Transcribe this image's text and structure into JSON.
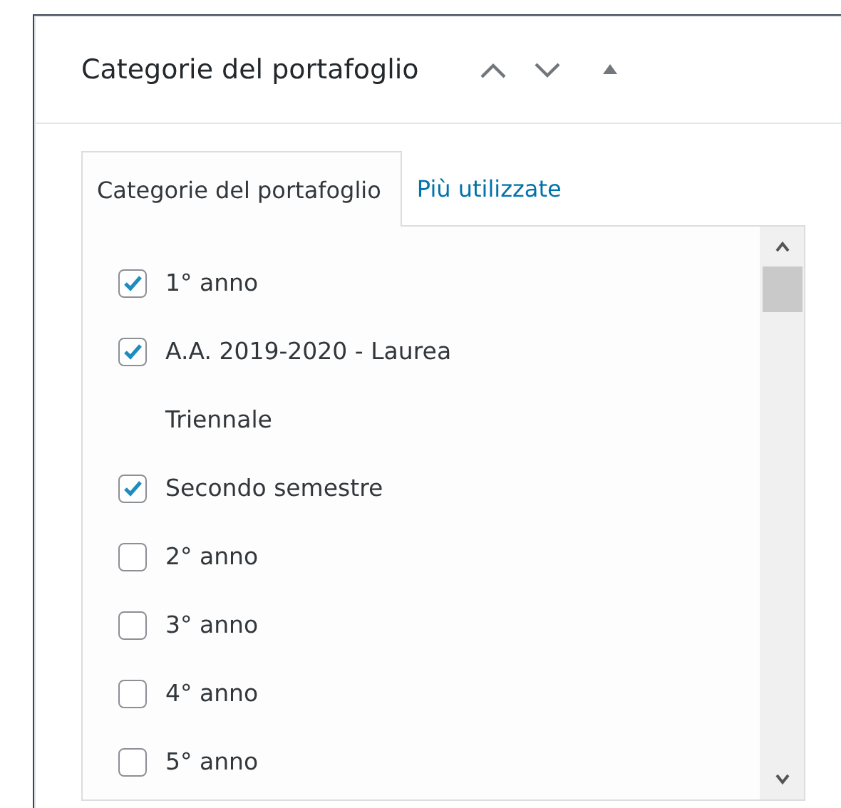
{
  "panel": {
    "title": "Categorie del portafoglio"
  },
  "tabs": [
    {
      "label": "Categorie del portafoglio",
      "selected": true
    },
    {
      "label": "Più utilizzate",
      "selected": false
    }
  ],
  "categories": [
    {
      "label": "1° anno",
      "checked": true
    },
    {
      "label": "A.A. 2019-2020 - Laurea Triennale",
      "checked": true
    },
    {
      "label": "Secondo semestre",
      "checked": true
    },
    {
      "label": "2° anno",
      "checked": false
    },
    {
      "label": "3° anno",
      "checked": false
    },
    {
      "label": "4° anno",
      "checked": false
    },
    {
      "label": "5° anno",
      "checked": false
    }
  ]
}
